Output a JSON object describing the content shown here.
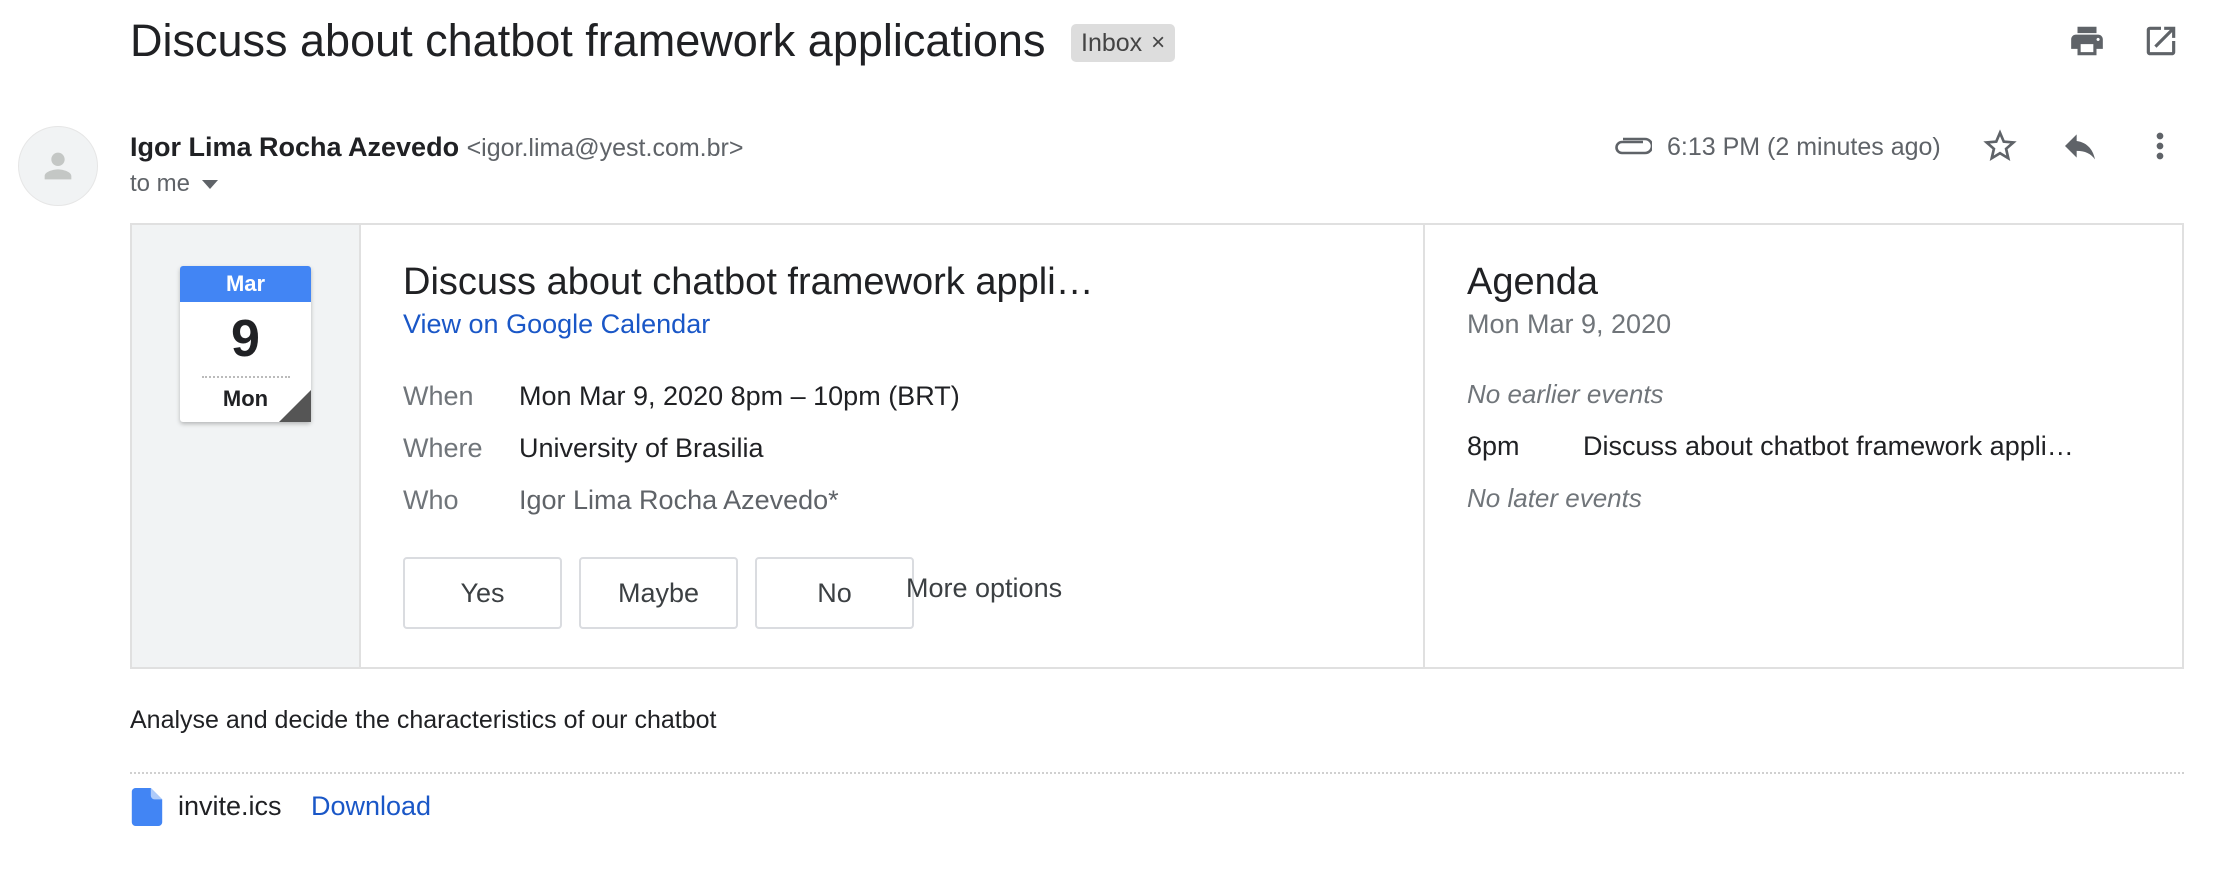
{
  "email": {
    "subject": "Discuss about chatbot framework applications",
    "label": "Inbox",
    "label_remove": "×",
    "sender_name": "Igor Lima Rocha Azevedo",
    "sender_email": "<igor.lima@yest.com.br>",
    "recipient": "to me",
    "time": "6:13 PM (2 minutes ago)",
    "body": "Analyse and decide the characteristics of our chatbot"
  },
  "calendar_icon": {
    "month": "Mar",
    "day": "9",
    "weekday": "Mon"
  },
  "event": {
    "title": "Discuss about chatbot framework appli…",
    "calendar_link": "View on Google Calendar",
    "rows": [
      {
        "label": "When",
        "value": "Mon Mar 9, 2020 8pm – 10pm (BRT)"
      },
      {
        "label": "Where",
        "value": "University of Brasilia"
      },
      {
        "label": "Who",
        "value": "Igor Lima Rocha Azevedo*"
      }
    ],
    "rsvp": {
      "yes": "Yes",
      "maybe": "Maybe",
      "no": "No",
      "more": "More options"
    }
  },
  "agenda": {
    "title": "Agenda",
    "date": "Mon Mar 9, 2020",
    "no_earlier": "No earlier events",
    "event_time": "8pm",
    "event_title": "Discuss about chatbot framework appli…",
    "no_later": "No later events"
  },
  "attachment": {
    "filename": "invite.ics",
    "download": "Download"
  },
  "colors": {
    "link": "#1a57c7",
    "calendar_header": "#4285f4",
    "file_icon": "#4285f4",
    "icon_gray": "#5f6368"
  },
  "icons": [
    "print-icon",
    "open-in-new-icon",
    "person-icon",
    "attachment-icon",
    "star-icon",
    "reply-icon",
    "more-vert-icon",
    "file-icon"
  ]
}
